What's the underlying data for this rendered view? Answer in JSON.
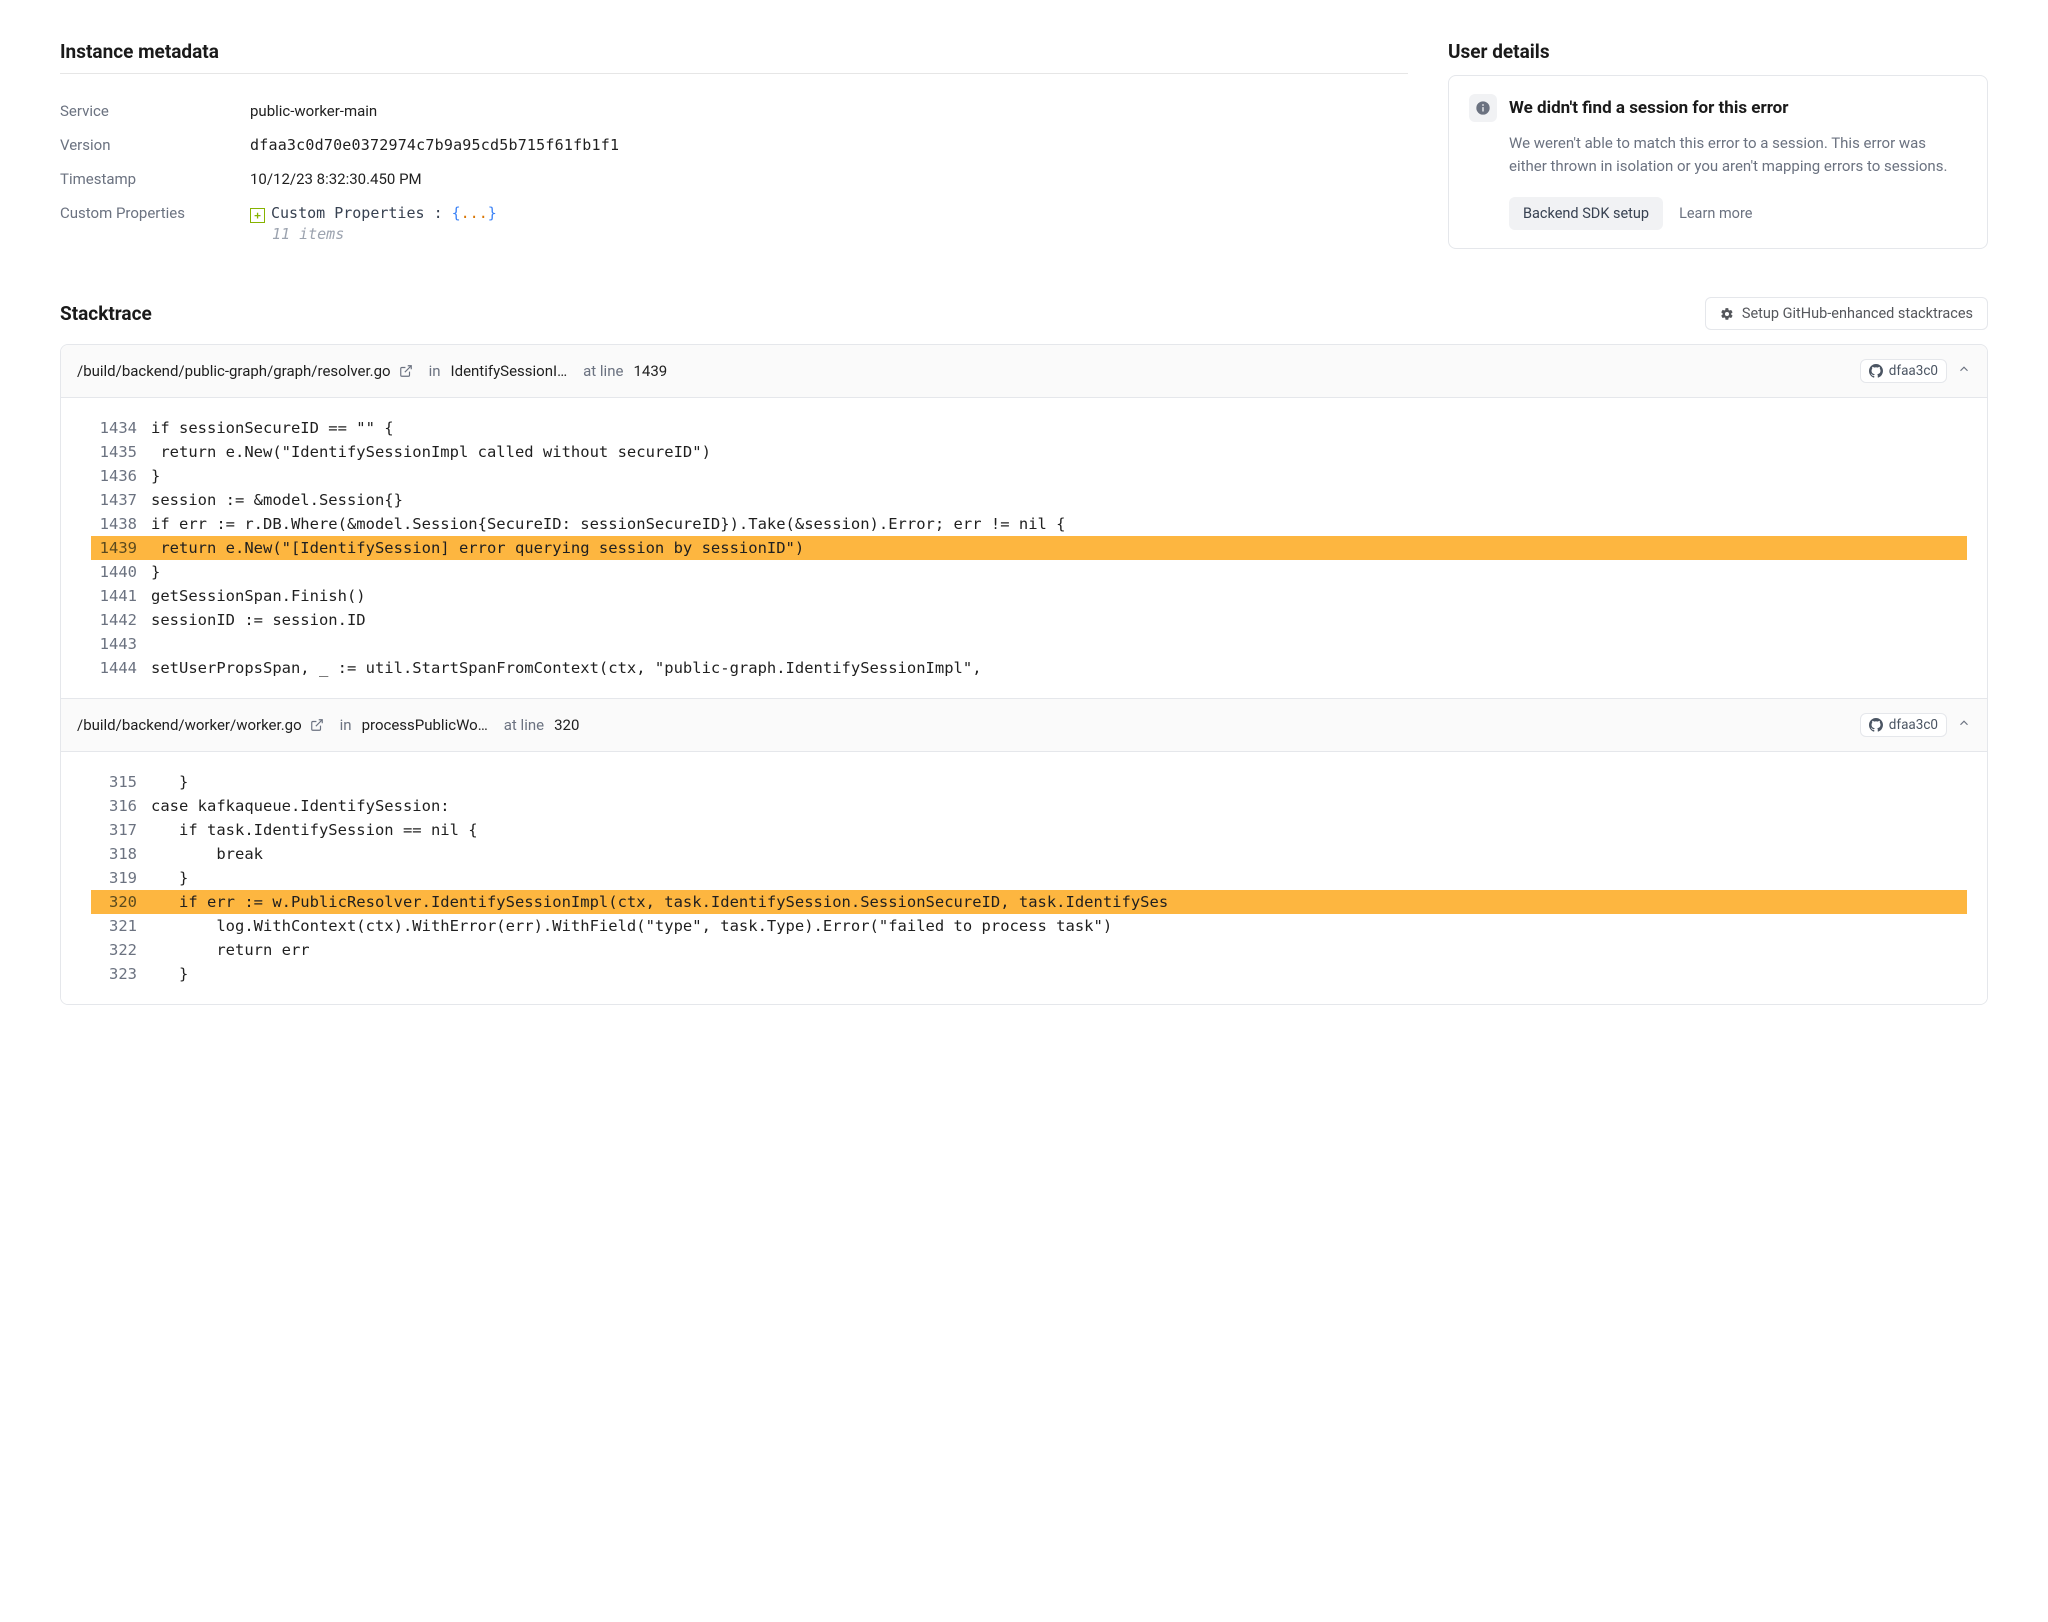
{
  "metadata": {
    "title": "Instance metadata",
    "service_label": "Service",
    "service_value": "public-worker-main",
    "version_label": "Version",
    "version_value": "dfaa3c0d70e0372974c7b9a95cd5b715f61fb1f1",
    "timestamp_label": "Timestamp",
    "timestamp_value": "10/12/23 8:32:30.450 PM",
    "custom_label": "Custom Properties",
    "custom_text": "Custom Properties ",
    "custom_colon": ": ",
    "custom_open": "{",
    "custom_ellipsis": "...",
    "custom_close": "}",
    "custom_count": "11 items"
  },
  "user": {
    "title": "User details",
    "heading": "We didn't find a session for this error",
    "body": "We weren't able to match this error to a session. This error was either thrown in isolation or you aren't mapping errors to sessions.",
    "sdk_btn": "Backend SDK setup",
    "learn_more": "Learn more"
  },
  "stack": {
    "title": "Stacktrace",
    "setup_btn": "Setup GitHub-enhanced stacktraces",
    "frames": [
      {
        "path": "/build/backend/public-graph/graph/resolver.go",
        "in_label": "in",
        "func": "IdentifySessionI…",
        "at_label": "at line",
        "line": "1439",
        "commit": "dfaa3c0",
        "highlight": 1439,
        "lines": [
          {
            "n": "1434",
            "t": "if sessionSecureID == \"\" {"
          },
          {
            "n": "1435",
            "t": " return e.New(\"IdentifySessionImpl called without secureID\")"
          },
          {
            "n": "1436",
            "t": "}"
          },
          {
            "n": "1437",
            "t": "session := &model.Session{}"
          },
          {
            "n": "1438",
            "t": "if err := r.DB.Where(&model.Session{SecureID: sessionSecureID}).Take(&session).Error; err != nil {"
          },
          {
            "n": "1439",
            "t": " return e.New(\"[IdentifySession] error querying session by sessionID\")"
          },
          {
            "n": "1440",
            "t": "}"
          },
          {
            "n": "1441",
            "t": "getSessionSpan.Finish()"
          },
          {
            "n": "1442",
            "t": "sessionID := session.ID"
          },
          {
            "n": "1443",
            "t": ""
          },
          {
            "n": "1444",
            "t": "setUserPropsSpan, _ := util.StartSpanFromContext(ctx, \"public-graph.IdentifySessionImpl\","
          }
        ]
      },
      {
        "path": "/build/backend/worker/worker.go",
        "in_label": "in",
        "func": "processPublicWo…",
        "at_label": "at line",
        "line": "320",
        "commit": "dfaa3c0",
        "highlight": 320,
        "lines": [
          {
            "n": "315",
            "t": "   }"
          },
          {
            "n": "316",
            "t": "case kafkaqueue.IdentifySession:"
          },
          {
            "n": "317",
            "t": "   if task.IdentifySession == nil {"
          },
          {
            "n": "318",
            "t": "       break"
          },
          {
            "n": "319",
            "t": "   }"
          },
          {
            "n": "320",
            "t": "   if err := w.PublicResolver.IdentifySessionImpl(ctx, task.IdentifySession.SessionSecureID, task.IdentifySes"
          },
          {
            "n": "321",
            "t": "       log.WithContext(ctx).WithError(err).WithField(\"type\", task.Type).Error(\"failed to process task\")"
          },
          {
            "n": "322",
            "t": "       return err"
          },
          {
            "n": "323",
            "t": "   }"
          }
        ]
      }
    ]
  }
}
